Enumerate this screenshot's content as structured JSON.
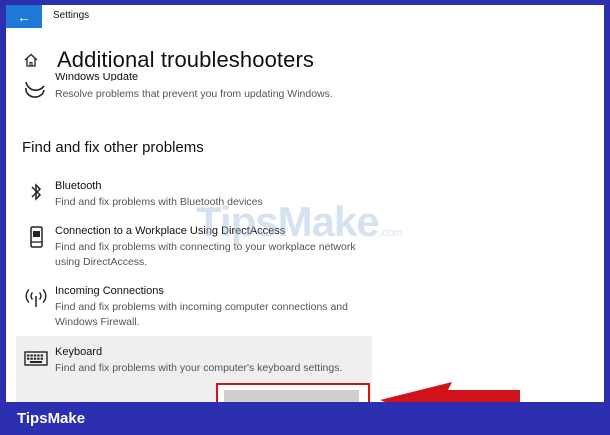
{
  "window": {
    "back_icon": "arrow-left-icon",
    "title": "Settings"
  },
  "header": {
    "home_icon": "home-icon",
    "title": "Additional troubleshooters"
  },
  "partial_item": {
    "icon": "refresh-icon",
    "label": "Windows Update",
    "description": "Resolve problems that prevent you from updating Windows."
  },
  "section": {
    "heading": "Find and fix other problems"
  },
  "items": [
    {
      "icon": "bluetooth-icon",
      "label": "Bluetooth",
      "description": "Find and fix problems with Bluetooth devices"
    },
    {
      "icon": "phone-device-icon",
      "label": "Connection to a Workplace Using DirectAccess",
      "description": "Find and fix problems with connecting to your workplace network using DirectAccess."
    },
    {
      "icon": "antenna-icon",
      "label": "Incoming Connections",
      "description": "Find and fix problems with incoming computer connections and Windows Firewall."
    },
    {
      "icon": "keyboard-icon",
      "label": "Keyboard",
      "description": "Find and fix problems with your computer's keyboard settings."
    }
  ],
  "watermark": {
    "text": "TipsMake",
    "suffix": ".com"
  },
  "annotation": {
    "color": "#d0121b"
  },
  "footer": {
    "brand": "TipsMake"
  },
  "colors": {
    "accent": "#1e7ad6",
    "brand_bg": "#2b2fb0",
    "highlight_bg": "#efefef"
  }
}
